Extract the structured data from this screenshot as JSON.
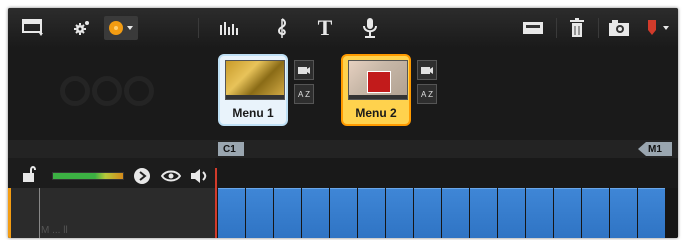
{
  "toolbar": {
    "left_icons": [
      "panel-toggle-icon",
      "settings-gear-icon",
      "disc-menu-icon"
    ],
    "center_icons": [
      "audio-bars-icon",
      "music-note-icon",
      "title-text-icon",
      "microphone-icon"
    ],
    "center_title_glyph": "T",
    "right_icons": [
      "storage-icon",
      "trash-icon",
      "camera-icon",
      "marker-icon"
    ]
  },
  "menus": [
    {
      "label": "Menu 1",
      "selected": false
    },
    {
      "label": "Menu 2",
      "selected": true
    }
  ],
  "menu_buttons": {
    "sort_label": "A Z"
  },
  "markers": {
    "chapter": "C1",
    "menu_return": "M1"
  },
  "track": {
    "ghost_label": "M ... ll"
  },
  "colors": {
    "accent": "#ff9a00",
    "selected_fill": "#ffd24d",
    "clip_blue": "#3f86d6",
    "playhead": "#d23b2b"
  }
}
